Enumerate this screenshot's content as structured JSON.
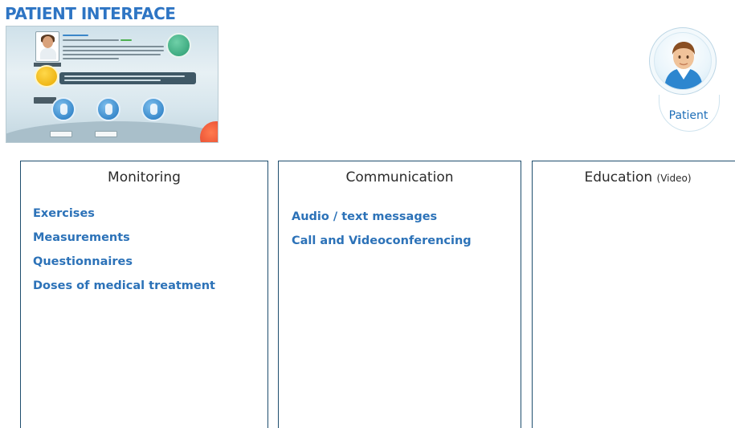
{
  "title": "PATIENT INTERFACE",
  "avatar": {
    "label": "Patient",
    "icon": "patient-avatar-icon"
  },
  "panels": [
    {
      "title": "Monitoring",
      "items": [
        "Exercises",
        "Measurements",
        "Questionnaires",
        "Doses of medical treatment"
      ]
    },
    {
      "title": "Communication",
      "items": [
        "Audio / text messages",
        "Call and Videoconferencing"
      ]
    },
    {
      "title": "Education",
      "title_suffix": "(Video)",
      "items": []
    }
  ],
  "colors": {
    "heading_blue": "#2e75c4",
    "item_blue": "#2c72b8",
    "panel_border": "#1f4e6e"
  }
}
